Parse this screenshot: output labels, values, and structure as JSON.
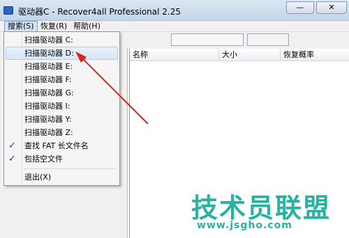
{
  "window": {
    "title": "驱动器C - Recover4all Professional 2.25"
  },
  "title_buttons": {
    "minimize": "—",
    "close": "✕"
  },
  "menubar": {
    "items": [
      {
        "label": "搜索(S)",
        "active": true
      },
      {
        "label": "恢复(R)",
        "active": false
      },
      {
        "label": "帮助(H)",
        "active": false
      }
    ]
  },
  "dropdown": {
    "items": [
      {
        "label": "扫描驱动器 C:",
        "checked": false,
        "hover": false
      },
      {
        "label": "扫描驱动器 D:",
        "checked": false,
        "hover": true
      },
      {
        "label": "扫描驱动器 E:",
        "checked": false,
        "hover": false
      },
      {
        "label": "扫描驱动器 F:",
        "checked": false,
        "hover": false
      },
      {
        "label": "扫描驱动器 G:",
        "checked": false,
        "hover": false
      },
      {
        "label": "扫描驱动器 I:",
        "checked": false,
        "hover": false
      },
      {
        "label": "扫描驱动器 Y:",
        "checked": false,
        "hover": false
      },
      {
        "label": "扫描驱动器 Z:",
        "checked": false,
        "hover": false
      },
      {
        "label": "查找 FAT 长文件名",
        "checked": true,
        "hover": false
      },
      {
        "label": "包括空文件",
        "checked": true,
        "hover": false
      },
      {
        "label": "退出(X)",
        "checked": false,
        "hover": false
      }
    ],
    "check_glyph": "✓"
  },
  "list": {
    "columns": [
      "名称",
      "大小",
      "恢复概率"
    ]
  },
  "watermark": {
    "title": "技术员联盟",
    "url": "www.jsgho.com"
  },
  "colors": {
    "arrow": "#e02020",
    "watermark": "#27b2a1",
    "menu_highlight": "#d8e6f6"
  }
}
